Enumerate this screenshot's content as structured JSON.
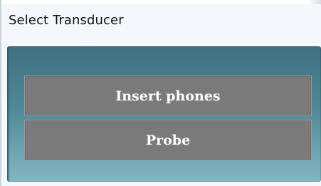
{
  "window": {
    "title": "Select Transducer"
  },
  "options": [
    {
      "label": "Insert phones"
    },
    {
      "label": "Probe"
    }
  ],
  "colors": {
    "panel_top": "#3f717f",
    "panel_bottom": "#82b6c0",
    "button_bg": "#7a7a7a",
    "button_text": "#ffffff"
  }
}
